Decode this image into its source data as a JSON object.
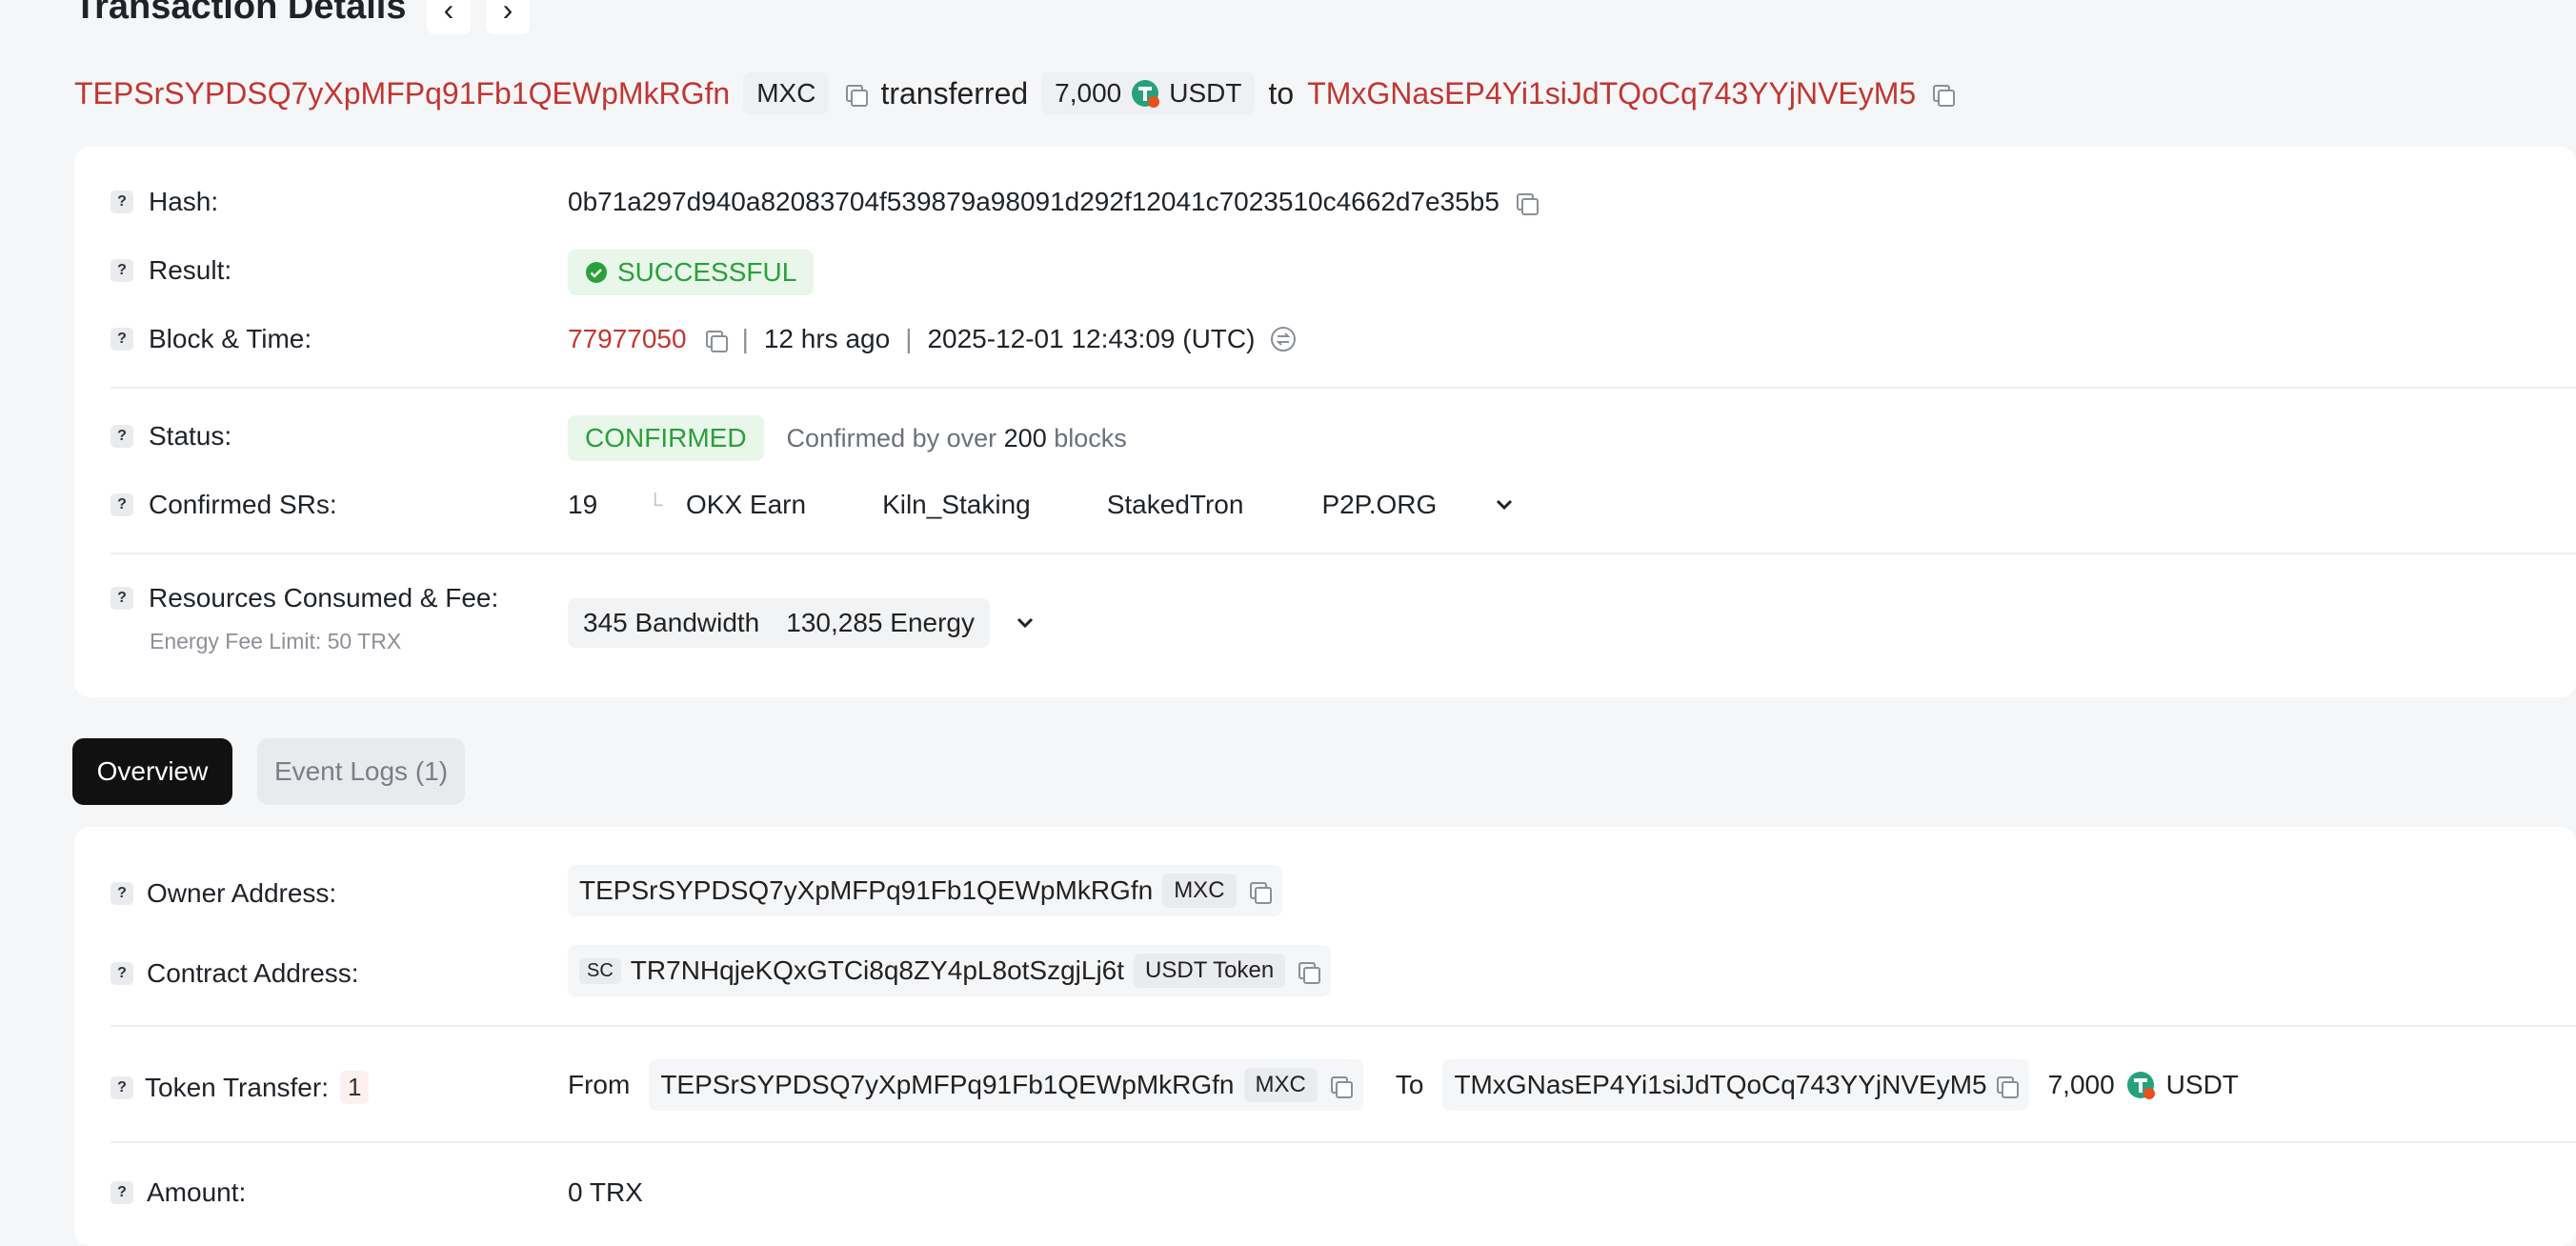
{
  "header": {
    "title": "Transaction Details",
    "from_address": "TEPSrSYPDSQ7yXpMFPq91Fb1QEWpMkRGfn",
    "from_tag": "MXC",
    "verb": "transferred",
    "amount": "7,000",
    "token": "USDT",
    "preposition": "to",
    "to_address": "TMxGNasEP4Yi1siJdTQoCq743YYjNVEyM5"
  },
  "details": {
    "hash": {
      "label": "Hash:",
      "value": "0b71a297d940a82083704f539879a98091d292f12041c7023510c4662d7e35b5"
    },
    "result": {
      "label": "Result:",
      "value": "SUCCESSFUL"
    },
    "block_time": {
      "label": "Block & Time:",
      "block": "77977050",
      "sep1": "|",
      "relative": "12 hrs ago",
      "sep2": "|",
      "datetime": "2025-12-01 12:43:09 (UTC)"
    },
    "status": {
      "label": "Status:",
      "value": "CONFIRMED",
      "note_prefix": "Confirmed by over",
      "note_count": "200",
      "note_suffix": "blocks"
    },
    "confirmed_srs": {
      "label": "Confirmed SRs:",
      "count": "19",
      "names": [
        "OKX Earn",
        "Kiln_Staking",
        "StakedTron",
        "P2P.ORG"
      ]
    },
    "resources": {
      "label": "Resources Consumed & Fee:",
      "sublabel": "Energy Fee Limit: 50 TRX",
      "bandwidth_value": "345",
      "bandwidth_label": "Bandwidth",
      "energy_value": "130,285",
      "energy_label": "Energy"
    }
  },
  "tabs": [
    {
      "label": "Overview",
      "active": true
    },
    {
      "label": "Event Logs (1)",
      "active": false
    }
  ],
  "overview": {
    "owner": {
      "label": "Owner Address:",
      "address": "TEPSrSYPDSQ7yXpMFPq91Fb1QEWpMkRGfn",
      "tag": "MXC"
    },
    "contract": {
      "label": "Contract Address:",
      "prefix": "SC",
      "address": "TR7NHqjeKQxGTCi8q8ZY4pL8otSzgjLj6t",
      "tag": "USDT Token"
    },
    "token_transfer": {
      "label": "Token Transfer:",
      "count": "1",
      "from_label": "From",
      "from_address": "TEPSrSYPDSQ7yXpMFPq91Fb1QEWpMkRGfn",
      "from_tag": "MXC",
      "to_label": "To",
      "to_address": "TMxGNasEP4Yi1siJdTQoCq743YYjNVEyM5",
      "amount": "7,000",
      "token": "USDT"
    },
    "amount": {
      "label": "Amount:",
      "value": "0 TRX"
    }
  },
  "icons": {
    "copy": "copy-icon",
    "prev": "chevron-left-icon",
    "next": "chevron-right-icon",
    "check": "check-circle-icon",
    "time_convert": "time-convert-icon",
    "expand": "chevron-down-icon",
    "token": "usdt-token-icon",
    "help": "question-icon"
  },
  "colors": {
    "link": "#c23631",
    "success": "#2aa03a",
    "success_bg": "#e9f6ea",
    "tether": "#26a17b",
    "active_tab": "#111111"
  }
}
